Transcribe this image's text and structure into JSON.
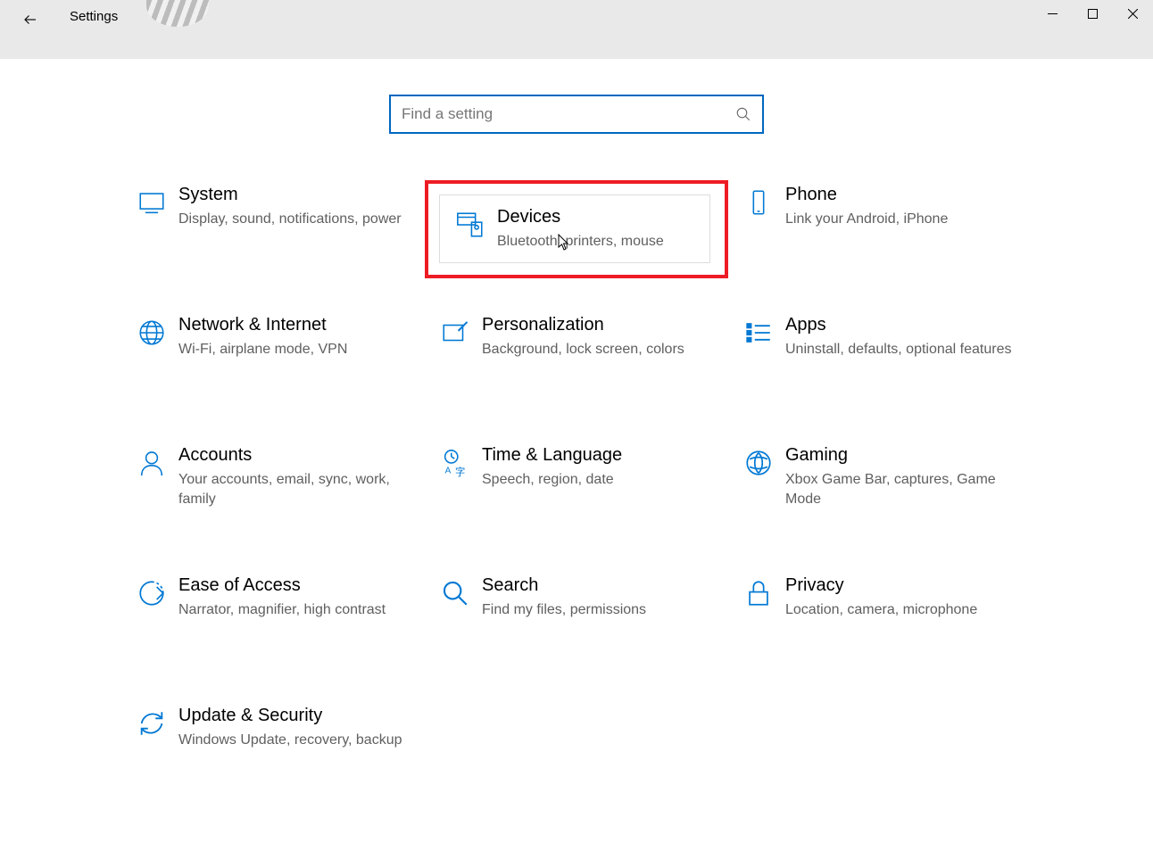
{
  "window": {
    "title": "Settings"
  },
  "search": {
    "placeholder": "Find a setting"
  },
  "tiles": [
    {
      "id": "system",
      "title": "System",
      "subtitle": "Display, sound, notifications, power"
    },
    {
      "id": "devices",
      "title": "Devices",
      "subtitle": "Bluetooth, printers, mouse",
      "highlighted": true
    },
    {
      "id": "phone",
      "title": "Phone",
      "subtitle": "Link your Android, iPhone"
    },
    {
      "id": "network",
      "title": "Network & Internet",
      "subtitle": "Wi-Fi, airplane mode, VPN"
    },
    {
      "id": "personalization",
      "title": "Personalization",
      "subtitle": "Background, lock screen, colors"
    },
    {
      "id": "apps",
      "title": "Apps",
      "subtitle": "Uninstall, defaults, optional features"
    },
    {
      "id": "accounts",
      "title": "Accounts",
      "subtitle": "Your accounts, email, sync, work, family"
    },
    {
      "id": "time-language",
      "title": "Time & Language",
      "subtitle": "Speech, region, date"
    },
    {
      "id": "gaming",
      "title": "Gaming",
      "subtitle": "Xbox Game Bar, captures, Game Mode"
    },
    {
      "id": "ease-of-access",
      "title": "Ease of Access",
      "subtitle": "Narrator, magnifier, high contrast"
    },
    {
      "id": "search",
      "title": "Search",
      "subtitle": "Find my files, permissions"
    },
    {
      "id": "privacy",
      "title": "Privacy",
      "subtitle": "Location, camera, microphone"
    },
    {
      "id": "update-security",
      "title": "Update & Security",
      "subtitle": "Windows Update, recovery, backup"
    }
  ]
}
